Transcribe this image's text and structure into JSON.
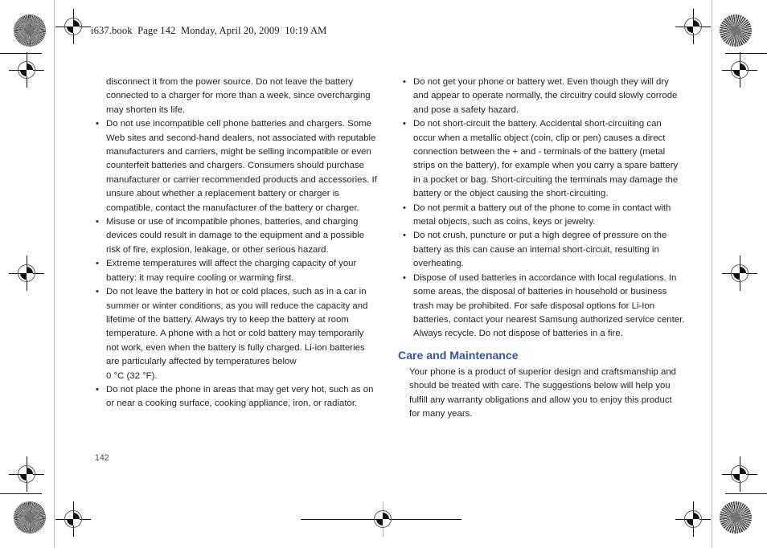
{
  "document": {
    "running_head": "i637.book  Page 142  Monday, April 20, 2009  10:19 AM",
    "folio": "142",
    "accent_color": "#3b53a4",
    "text_color": "#231f20"
  },
  "left_column": {
    "continued_paragraph": "disconnect it from the power source. Do not leave the battery connected to a charger for more than a week, since overcharging may shorten its life.",
    "bullet_glyph": "•",
    "bullets": [
      "Do not use incompatible cell phone batteries and chargers. Some Web sites and second-hand dealers, not associated with reputable manufacturers and carriers, might be selling incompatible or even counterfeit batteries and chargers. Consumers should purchase manufacturer or carrier recommended products and accessories. If unsure about whether a replacement battery or charger is compatible, contact the manufacturer of the battery or charger.",
      "Misuse or use of incompatible phones, batteries, and charging devices could result in damage to the equipment and a possible risk of fire, explosion, leakage, or other serious hazard.",
      "Extreme temperatures will affect the charging capacity of your battery: it may require cooling or warming first.",
      "Do not leave the battery in hot or cold places, such as in a car in summer or winter conditions, as you will reduce the capacity and lifetime of the battery. Always try to keep the battery at room temperature. A phone with a hot or cold battery may temporarily not work, even when the battery is fully charged. Li-ion batteries are particularly affected by temperatures below\n0 °C (32 °F).",
      "Do not place the phone in areas that may get very hot, such as on or near a cooking surface, cooking appliance, iron, or radiator."
    ]
  },
  "right_column": {
    "bullet_glyph": "•",
    "bullets": [
      "Do not get your phone or battery wet. Even though they will dry and appear to operate normally, the circuitry could slowly corrode and pose a safety hazard.",
      "Do not short-circuit the battery. Accidental short-circuiting can occur when a metallic object (coin, clip or pen) causes a direct connection between the + and - terminals of the battery (metal strips on the battery), for example when you carry a spare battery in a pocket or bag. Short-circuiting the terminals may damage the battery or the object causing the short-circuiting.",
      "Do not permit a battery out of the phone to come in contact with metal objects, such as coins, keys or jewelry.",
      "Do not crush, puncture or put a high degree of pressure on the battery as this can cause an internal short-circuit, resulting in overheating.",
      "Dispose of used batteries in accordance with local regulations. In some areas, the disposal of batteries in household or business trash may be prohibited. For safe disposal options for Li-Ion batteries, contact your nearest Samsung authorized service center. Always recycle. Do not dispose of batteries in a fire."
    ],
    "section_heading": "Care and Maintenance",
    "section_body": "Your phone is a product of superior design and craftsmanship and should be treated with care. The suggestions below will help you fulfill any warranty obligations and allow you to enjoy this product for many years."
  },
  "printer_marks": {
    "registration_mark_label": "registration-target",
    "star_target_label": "star-density-target",
    "trim_line_label": "trim-line",
    "gutter_rule_label": "gutter-rule"
  }
}
